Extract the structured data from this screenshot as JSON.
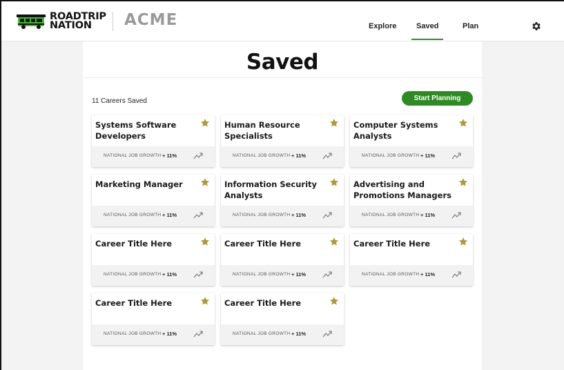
{
  "header": {
    "logo_line1": "ROADTRIP",
    "logo_line2": "NATION",
    "brand": "ACME",
    "nav": [
      {
        "label": "Explore",
        "active": false
      },
      {
        "label": "Saved",
        "active": true
      },
      {
        "label": "Plan",
        "active": false
      }
    ],
    "settings_icon": "gear-icon"
  },
  "main": {
    "title": "Saved",
    "count_text": "11 Careers Saved",
    "start_button": "Start Planning",
    "cards": [
      {
        "title": "Systems Software Developers",
        "growth_label": "NATIONAL JOB GROWTH",
        "growth_value": "+ 11%"
      },
      {
        "title": "Human Resource Specialists",
        "growth_label": "NATIONAL JOB GROWTH",
        "growth_value": "+ 11%"
      },
      {
        "title": "Computer Systems Analysts",
        "growth_label": "NATIONAL JOB GROWTH",
        "growth_value": "+ 11%"
      },
      {
        "title": "Marketing Manager",
        "growth_label": "NATIONAL JOB GROWTH",
        "growth_value": "+ 11%"
      },
      {
        "title": "Information Security Analysts",
        "growth_label": "NATIONAL JOB GROWTH",
        "growth_value": "+ 11%"
      },
      {
        "title": "Advertising and Promotions Managers",
        "growth_label": "NATIONAL JOB GROWTH",
        "growth_value": "+ 11%"
      },
      {
        "title": "Career Title Here",
        "growth_label": "NATIONAL JOB GROWTH",
        "growth_value": "+ 11%"
      },
      {
        "title": "Career Title Here",
        "growth_label": "NATIONAL JOB GROWTH",
        "growth_value": "+ 11%"
      },
      {
        "title": "Career Title Here",
        "growth_label": "NATIONAL JOB GROWTH",
        "growth_value": "+ 11%"
      },
      {
        "title": "Career Title Here",
        "growth_label": "NATIONAL JOB GROWTH",
        "growth_value": "+ 11%"
      },
      {
        "title": "Career Title Here",
        "growth_label": "NATIONAL JOB GROWTH",
        "growth_value": "+ 11%"
      }
    ]
  },
  "colors": {
    "accent_green": "#2e8b24",
    "star_gold": "#b09a36",
    "brand_gray": "#9a9a9a",
    "logo_green": "#3fbf2e"
  },
  "icons": {
    "star": "star-icon",
    "trend": "trend-up-icon"
  }
}
